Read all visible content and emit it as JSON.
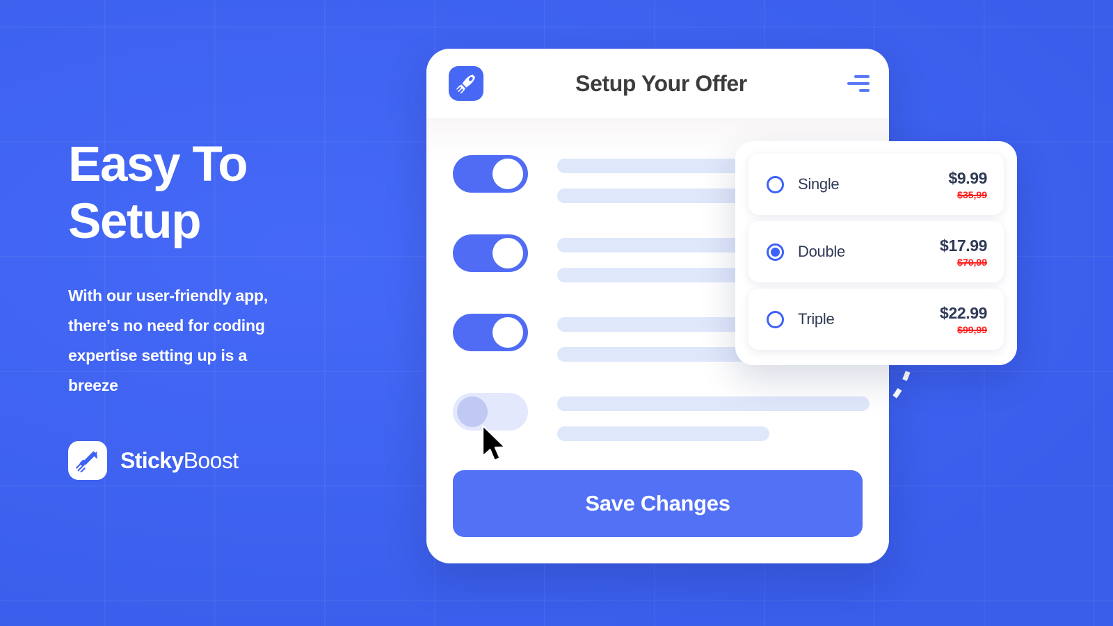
{
  "brand": {
    "name_bold": "Sticky",
    "name_light": "Boost",
    "mark_icon": "rocket-arrow-icon",
    "accent_color": "#3D62F7"
  },
  "hero": {
    "headline_line1": "Easy To",
    "headline_line2": "Setup",
    "subcopy": "With our user-friendly app, there's no need for coding expertise setting up is a breeze"
  },
  "phone": {
    "app_icon": "rocket-icon",
    "title": "Setup Your Offer",
    "menu_icon": "hamburger-menu-icon",
    "save_button_label": "Save Changes",
    "toggles": [
      {
        "name": "offer-toggle-1",
        "state": "on"
      },
      {
        "name": "offer-toggle-2",
        "state": "on"
      },
      {
        "name": "offer-toggle-3",
        "state": "on"
      },
      {
        "name": "offer-toggle-4",
        "state": "off"
      }
    ],
    "cursor_icon": "mouse-pointer-icon"
  },
  "pricing": {
    "options": [
      {
        "label": "Single",
        "price": "$9.99",
        "old_price": "$35,99",
        "selected": false
      },
      {
        "label": "Double",
        "price": "$17.99",
        "old_price": "$70,99",
        "selected": true
      },
      {
        "label": "Triple",
        "price": "$22.99",
        "old_price": "$99,99",
        "selected": false
      }
    ],
    "old_price_color": "#FF2020"
  },
  "decor": {
    "dashed_arc": "dashed-curve-decoration",
    "background": "blue-grid-background"
  }
}
